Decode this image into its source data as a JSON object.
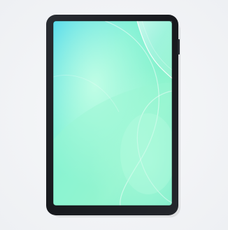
{
  "image": {
    "subject": "tablet-with-screen-protector-film",
    "colors": {
      "background": "#f2f3f5",
      "device_frame": "#1e2024",
      "screen_mint": "#8ef2cf",
      "screen_teal": "#34d0b8",
      "screen_cyan": "#5fd7f2"
    }
  }
}
